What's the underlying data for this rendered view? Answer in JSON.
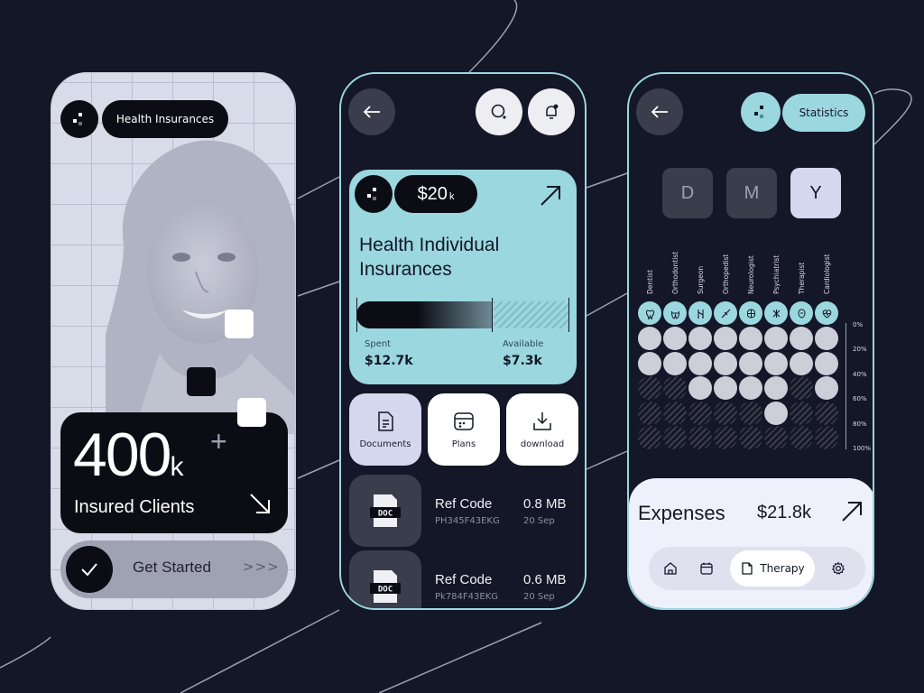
{
  "phone1": {
    "badge_label": "Health Insurances",
    "stat_number": "400",
    "stat_unit": "k",
    "stat_plus": "+",
    "stat_label": "Insured Clients",
    "cta_label": "Get Started",
    "cta_chevrons": ">>>"
  },
  "phone2": {
    "price": "$20",
    "price_unit": "k",
    "card_title": "Health Individual Insurances",
    "spent_label": "Spent",
    "spent_value": "$12.7k",
    "available_label": "Available",
    "available_value": "$7.3k",
    "spent_fraction": 0.635,
    "actions": [
      {
        "label": "Documents",
        "icon": "document-icon"
      },
      {
        "label": "Plans",
        "icon": "calendar-icon"
      },
      {
        "label": "download",
        "icon": "download-icon"
      }
    ],
    "doc_badge": "DOC",
    "documents": [
      {
        "title": "Ref Code",
        "id": "PH345F43EKG",
        "size": "0.8 MB",
        "date": "20 Sep"
      },
      {
        "title": "Ref Code",
        "id": "Pk784F43EKG",
        "size": "0.6 MB",
        "date": "20 Sep"
      }
    ]
  },
  "phone3": {
    "statistics_label": "Statistics",
    "periods": [
      "D",
      "M",
      "Y"
    ],
    "selected_period": "Y",
    "specialists": [
      "Dentist",
      "Orthodontist",
      "Surgeon",
      "Orthopedist",
      "Neurologist",
      "Psychiatrist",
      "Therapist",
      "Cardiologist"
    ],
    "percent_labels": [
      "0%",
      "20%",
      "40%",
      "60%",
      "80%",
      "100%"
    ],
    "filled_dots_per_column": [
      2,
      2,
      3,
      3,
      3,
      4,
      2,
      3
    ],
    "expenses_label": "Expenses",
    "expenses_value": "$21.8k",
    "nav": {
      "active_label": "Therapy",
      "icons": [
        "home-icon",
        "calendar-icon",
        "therapy-icon",
        "gear-icon"
      ]
    }
  },
  "colors": {
    "background": "#141727",
    "accent_teal": "#9bd7df",
    "lavender": "#d5d7ee",
    "dark_tile": "#3a3d4c"
  }
}
